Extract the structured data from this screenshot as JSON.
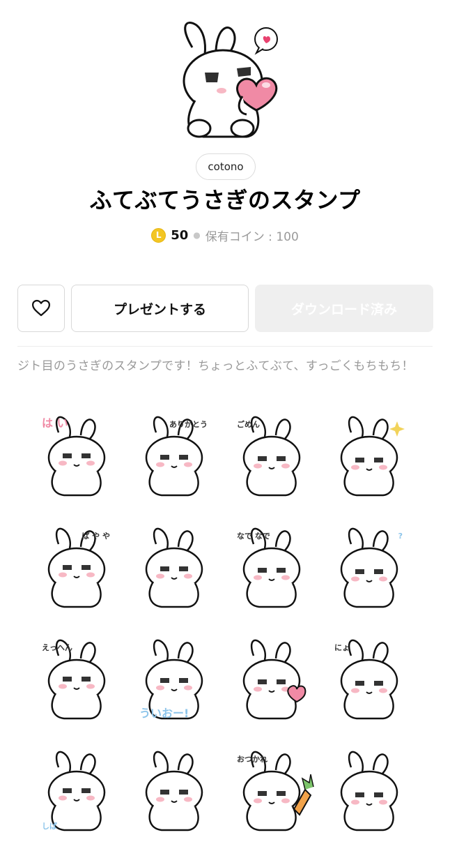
{
  "author": "cotono",
  "title": "ふてぶてうさぎのスタンプ",
  "coin_symbol": "L",
  "price": "50",
  "held_coins": "保有コイン : 100",
  "buttons": {
    "favorite_icon": "heart-outline-icon",
    "gift_label": "プレゼントする",
    "download_label": "ダウンロード済み"
  },
  "description": "ジト目のうさぎのスタンプです！ちょっとふてぶて、すっごくもちもち！",
  "stickers": [
    {
      "text": "は い"
    },
    {
      "text": "ありがとう"
    },
    {
      "text": "ごめん"
    },
    {
      "text": ""
    },
    {
      "text": "ぱ や や"
    },
    {
      "text": ""
    },
    {
      "text": "なで なで"
    },
    {
      "text": "?"
    },
    {
      "text": "えっへん"
    },
    {
      "text": "ういおー!"
    },
    {
      "text": ""
    },
    {
      "text": "にょ"
    },
    {
      "text": "しば"
    },
    {
      "text": ""
    },
    {
      "text": "おつかれ"
    },
    {
      "text": ""
    }
  ],
  "colors": {
    "coin": "#f3c623",
    "download_disabled_bg": "#efefef",
    "blush": "#f7b8c4",
    "heart": "#f08aa5",
    "accent_blue": "#8cc4ea"
  }
}
